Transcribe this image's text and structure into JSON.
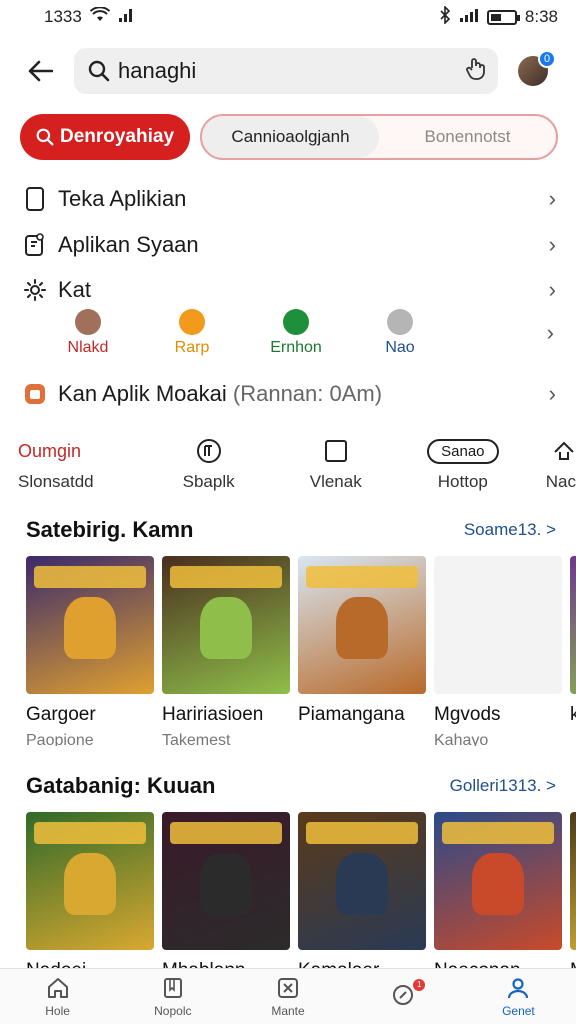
{
  "status": {
    "time_left": "1333",
    "time_right": "8:38"
  },
  "header": {
    "search_value": "hanaghi",
    "avatar_badge": "0"
  },
  "chips": {
    "primary": "Denroyahiay",
    "seg_active": "Cannioaolgjanh",
    "seg_inactive": "Bonennotst"
  },
  "menu": {
    "row1": "Teka Aplikian",
    "row2": "Aplikan Syaan",
    "row3": "Kat",
    "row4": "Kan Aplik Moakai",
    "row4_sub": "(Rannan: 0Am)"
  },
  "kat_apps": [
    {
      "label": "Nlakd",
      "color": "#c62828",
      "icon_color": "#a0705a"
    },
    {
      "label": "Rarp",
      "color": "#e58c00",
      "icon_color": "#f29a1b"
    },
    {
      "label": "Ernhon",
      "color": "#1b7a2e",
      "icon_color": "#1e8f3a"
    },
    {
      "label": "Nao",
      "color": "#1f4f8f",
      "icon_color": "#b5b5b5"
    }
  ],
  "quick": [
    {
      "top": "Oumgin",
      "bot": "Slonsatdd"
    },
    {
      "top": "",
      "bot": "Sbaplk"
    },
    {
      "top": "",
      "bot": "Vlenak"
    },
    {
      "top": "Sanao",
      "bot": "Hottop"
    },
    {
      "top": "",
      "bot": "Nac"
    }
  ],
  "section1": {
    "title": "Satebirig. Kamn",
    "link": "Soame13. >",
    "cards": [
      {
        "title": "Gargoer",
        "sub": "Paopione",
        "bg": "#3a2a6b",
        "accent": "#e0a030"
      },
      {
        "title": "Haririasioen",
        "sub": "Takemest",
        "bg": "#4a2e1f",
        "accent": "#8fbf4a"
      },
      {
        "title": "Piamangana",
        "sub": "",
        "bg": "#d8e6f2",
        "accent": "#b86a2a"
      },
      {
        "title": "Mgvods",
        "sub": "Kahayo",
        "bg": "#f3f3f3",
        "accent": "#f3f3f3"
      },
      {
        "title": "kat",
        "sub": "",
        "bg": "#6b3a8a",
        "accent": "#8fbf4a"
      }
    ]
  },
  "section2": {
    "title": "Gatabanig: Kuuan",
    "link": "Golleri1313. >",
    "cards": [
      {
        "title": "Nadoei",
        "sub": "",
        "bg": "#2f6a2a",
        "accent": "#d9a830"
      },
      {
        "title": "Mhablann",
        "sub": "",
        "bg": "#3a1a2a",
        "accent": "#2b2b2b"
      },
      {
        "title": "Kamalaer",
        "sub": "",
        "bg": "#5a3a1a",
        "accent": "#2a3a55"
      },
      {
        "title": "Naeconan",
        "sub": "",
        "bg": "#2a4a8a",
        "accent": "#c84a2a"
      },
      {
        "title": "M",
        "sub": "",
        "bg": "#4a3a1a",
        "accent": "#e0c040"
      }
    ]
  },
  "nav": [
    {
      "label": "Hole",
      "icon": "home-icon"
    },
    {
      "label": "Nopolc",
      "icon": "book-icon"
    },
    {
      "label": "Mante",
      "icon": "tag-icon"
    },
    {
      "label": "",
      "icon": "update-icon",
      "badge": "1"
    },
    {
      "label": "Genet",
      "icon": "person-icon"
    }
  ]
}
